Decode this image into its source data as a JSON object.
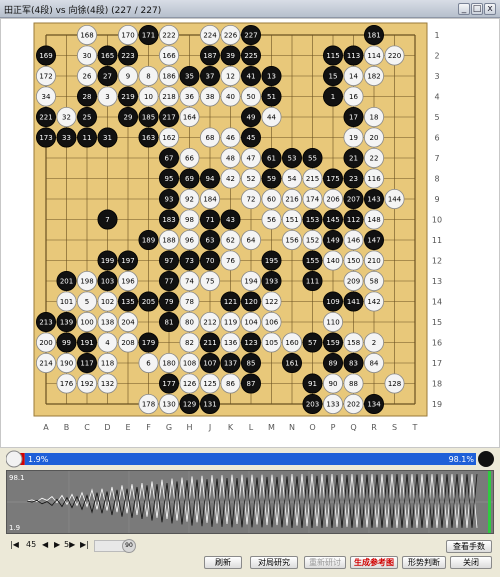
{
  "window": {
    "title": "田正军(4段) vs 向徐(4段) (227 / 227)",
    "min_label": "_",
    "max_label": "□",
    "close_label": "x"
  },
  "board": {
    "size": 19,
    "col_labels": [
      "A",
      "B",
      "C",
      "D",
      "E",
      "F",
      "G",
      "H",
      "J",
      "K",
      "L",
      "M",
      "N",
      "O",
      "P",
      "Q",
      "R",
      "S",
      "T"
    ],
    "row_labels": [
      "1",
      "2",
      "3",
      "4",
      "5",
      "6",
      "7",
      "8",
      "9",
      "10",
      "11",
      "12",
      "13",
      "14",
      "15",
      "16",
      "17",
      "18",
      "19"
    ],
    "colors": {
      "board": "#e8c87a",
      "lines": "#6a5120",
      "black": "#111111",
      "white": "#f4f4f4"
    },
    "stones": [
      [
        "C1",
        "w",
        168
      ],
      [
        "E1",
        "w",
        170
      ],
      [
        "F1",
        "b",
        171
      ],
      [
        "G1",
        "w",
        222
      ],
      [
        "J1",
        "w",
        224
      ],
      [
        "K1",
        "w",
        226
      ],
      [
        "L1",
        "b",
        227
      ],
      [
        "R1",
        "b",
        181
      ],
      [
        "A2",
        "b",
        169
      ],
      [
        "C2",
        "w",
        30
      ],
      [
        "D2",
        "b",
        165
      ],
      [
        "E2",
        "b",
        223
      ],
      [
        "G2",
        "w",
        166
      ],
      [
        "J2",
        "b",
        187
      ],
      [
        "K2",
        "b",
        39
      ],
      [
        "L2",
        "b",
        225
      ],
      [
        "P2",
        "b",
        115
      ],
      [
        "Q2",
        "b",
        113
      ],
      [
        "R2",
        "w",
        114
      ],
      [
        "S2",
        "w",
        220
      ],
      [
        "A3",
        "w",
        172
      ],
      [
        "C3",
        "w",
        26
      ],
      [
        "D3",
        "b",
        27
      ],
      [
        "E3",
        "w",
        9
      ],
      [
        "F3",
        "w",
        8
      ],
      [
        "G3",
        "w",
        186
      ],
      [
        "H3",
        "b",
        35
      ],
      [
        "J3",
        "b",
        37
      ],
      [
        "K3",
        "w",
        12
      ],
      [
        "L3",
        "b",
        41
      ],
      [
        "M3",
        "b",
        13
      ],
      [
        "P3",
        "b",
        15
      ],
      [
        "Q3",
        "w",
        14
      ],
      [
        "R3",
        "w",
        182
      ],
      [
        "A4",
        "w",
        34
      ],
      [
        "C4",
        "b",
        28
      ],
      [
        "D4",
        "w",
        3
      ],
      [
        "E4",
        "b",
        219
      ],
      [
        "F4",
        "w",
        10
      ],
      [
        "G4",
        "w",
        218
      ],
      [
        "H4",
        "w",
        36
      ],
      [
        "J4",
        "w",
        38
      ],
      [
        "K4",
        "w",
        40
      ],
      [
        "L4",
        "w",
        50
      ],
      [
        "M4",
        "b",
        51
      ],
      [
        "P4",
        "b",
        1
      ],
      [
        "Q4",
        "w",
        16
      ],
      [
        "A5",
        "b",
        221
      ],
      [
        "B5",
        "w",
        32
      ],
      [
        "C5",
        "b",
        25
      ],
      [
        "E5",
        "b",
        29
      ],
      [
        "F5",
        "b",
        185
      ],
      [
        "G5",
        "b",
        217
      ],
      [
        "H5",
        "w",
        164
      ],
      [
        "L5",
        "b",
        49
      ],
      [
        "M5",
        "w",
        44
      ],
      [
        "Q5",
        "b",
        17
      ],
      [
        "R5",
        "w",
        18
      ],
      [
        "A6",
        "b",
        173
      ],
      [
        "B6",
        "b",
        33
      ],
      [
        "C6",
        "b",
        11
      ],
      [
        "D6",
        "b",
        31
      ],
      [
        "F6",
        "b",
        163
      ],
      [
        "G6",
        "w",
        162
      ],
      [
        "J6",
        "w",
        68
      ],
      [
        "K6",
        "w",
        46
      ],
      [
        "L6",
        "b",
        45
      ],
      [
        "Q6",
        "w",
        19
      ],
      [
        "R6",
        "w",
        20
      ],
      [
        "G7",
        "b",
        67
      ],
      [
        "H7",
        "w",
        66
      ],
      [
        "K7",
        "w",
        48
      ],
      [
        "L7",
        "w",
        47
      ],
      [
        "M7",
        "b",
        61
      ],
      [
        "N7",
        "b",
        53
      ],
      [
        "O7",
        "b",
        55
      ],
      [
        "Q7",
        "b",
        21
      ],
      [
        "R7",
        "w",
        22
      ],
      [
        "G8",
        "b",
        95
      ],
      [
        "H8",
        "b",
        69
      ],
      [
        "J8",
        "b",
        94
      ],
      [
        "K8",
        "w",
        42
      ],
      [
        "L8",
        "w",
        52
      ],
      [
        "M8",
        "b",
        59
      ],
      [
        "N8",
        "w",
        54
      ],
      [
        "O8",
        "w",
        215
      ],
      [
        "P8",
        "b",
        175
      ],
      [
        "Q8",
        "b",
        23
      ],
      [
        "R8",
        "w",
        116
      ],
      [
        "G9",
        "b",
        93
      ],
      [
        "H9",
        "w",
        92
      ],
      [
        "J9",
        "w",
        184
      ],
      [
        "L9",
        "w",
        72
      ],
      [
        "M9",
        "w",
        60
      ],
      [
        "N9",
        "w",
        216
      ],
      [
        "O9",
        "w",
        174
      ],
      [
        "P9",
        "w",
        206
      ],
      [
        "Q9",
        "b",
        207
      ],
      [
        "R9",
        "b",
        143
      ],
      [
        "S9",
        "w",
        144
      ],
      [
        "D10",
        "b",
        7
      ],
      [
        "G10",
        "b",
        183
      ],
      [
        "H10",
        "w",
        98
      ],
      [
        "J10",
        "b",
        71
      ],
      [
        "K10",
        "b",
        43
      ],
      [
        "M10",
        "w",
        56
      ],
      [
        "N10",
        "w",
        151
      ],
      [
        "O10",
        "b",
        153
      ],
      [
        "P10",
        "b",
        145
      ],
      [
        "Q10",
        "b",
        112
      ],
      [
        "R10",
        "w",
        148
      ],
      [
        "F11",
        "b",
        189
      ],
      [
        "G11",
        "w",
        188
      ],
      [
        "H11",
        "w",
        96
      ],
      [
        "J11",
        "b",
        63
      ],
      [
        "K11",
        "w",
        62
      ],
      [
        "L11",
        "w",
        64
      ],
      [
        "N11",
        "w",
        156
      ],
      [
        "O11",
        "w",
        152
      ],
      [
        "P11",
        "b",
        149
      ],
      [
        "Q11",
        "w",
        146
      ],
      [
        "R11",
        "b",
        147
      ],
      [
        "D12",
        "b",
        199
      ],
      [
        "E12",
        "b",
        197
      ],
      [
        "G12",
        "b",
        97
      ],
      [
        "H12",
        "b",
        73
      ],
      [
        "J12",
        "b",
        70
      ],
      [
        "K12",
        "w",
        76
      ],
      [
        "M12",
        "b",
        195
      ],
      [
        "O12",
        "b",
        155
      ],
      [
        "P12",
        "w",
        140
      ],
      [
        "Q12",
        "w",
        150
      ],
      [
        "R12",
        "w",
        210
      ],
      [
        "B13",
        "b",
        201
      ],
      [
        "C13",
        "w",
        198
      ],
      [
        "D13",
        "b",
        103
      ],
      [
        "E13",
        "w",
        196
      ],
      [
        "G13",
        "b",
        77
      ],
      [
        "H13",
        "w",
        74
      ],
      [
        "J13",
        "w",
        75
      ],
      [
        "L13",
        "w",
        194
      ],
      [
        "M13",
        "b",
        193
      ],
      [
        "O13",
        "b",
        111
      ],
      [
        "Q13",
        "w",
        209
      ],
      [
        "R13",
        "w",
        58
      ],
      [
        "B14",
        "w",
        101
      ],
      [
        "C14",
        "w",
        5
      ],
      [
        "D14",
        "w",
        102
      ],
      [
        "E14",
        "b",
        135
      ],
      [
        "F14",
        "b",
        205
      ],
      [
        "G14",
        "b",
        79
      ],
      [
        "H14",
        "w",
        78
      ],
      [
        "K14",
        "b",
        121
      ],
      [
        "L14",
        "b",
        120
      ],
      [
        "M14",
        "w",
        122
      ],
      [
        "P14",
        "b",
        109
      ],
      [
        "Q14",
        "b",
        141
      ],
      [
        "R14",
        "w",
        142
      ],
      [
        "A15",
        "b",
        213
      ],
      [
        "B15",
        "b",
        139
      ],
      [
        "C15",
        "w",
        100
      ],
      [
        "D15",
        "w",
        138
      ],
      [
        "E15",
        "w",
        204
      ],
      [
        "G15",
        "b",
        81
      ],
      [
        "H15",
        "w",
        80
      ],
      [
        "J15",
        "w",
        212
      ],
      [
        "K15",
        "w",
        119
      ],
      [
        "L15",
        "w",
        104
      ],
      [
        "M15",
        "w",
        106
      ],
      [
        "P15",
        "w",
        110
      ],
      [
        "A16",
        "w",
        200
      ],
      [
        "B16",
        "b",
        99
      ],
      [
        "C16",
        "b",
        191
      ],
      [
        "D16",
        "w",
        4
      ],
      [
        "E16",
        "w",
        208
      ],
      [
        "F16",
        "b",
        179
      ],
      [
        "H16",
        "w",
        82
      ],
      [
        "J16",
        "b",
        211
      ],
      [
        "K16",
        "w",
        136
      ],
      [
        "L16",
        "b",
        123
      ],
      [
        "M16",
        "w",
        105
      ],
      [
        "N16",
        "w",
        160
      ],
      [
        "O16",
        "b",
        57
      ],
      [
        "P16",
        "b",
        159
      ],
      [
        "Q16",
        "w",
        158
      ],
      [
        "R16",
        "w",
        2
      ],
      [
        "A17",
        "w",
        214
      ],
      [
        "B17",
        "w",
        190
      ],
      [
        "C17",
        "b",
        117
      ],
      [
        "D17",
        "w",
        118
      ],
      [
        "F17",
        "w",
        6
      ],
      [
        "G17",
        "w",
        180
      ],
      [
        "H17",
        "w",
        108
      ],
      [
        "J17",
        "b",
        107
      ],
      [
        "K17",
        "b",
        137
      ],
      [
        "L17",
        "b",
        85
      ],
      [
        "N17",
        "b",
        161
      ],
      [
        "P17",
        "b",
        89
      ],
      [
        "Q17",
        "b",
        83
      ],
      [
        "R17",
        "w",
        84
      ],
      [
        "B18",
        "w",
        176
      ],
      [
        "C18",
        "w",
        192
      ],
      [
        "D18",
        "w",
        132
      ],
      [
        "G18",
        "b",
        177
      ],
      [
        "H18",
        "w",
        126
      ],
      [
        "J18",
        "w",
        125
      ],
      [
        "K18",
        "w",
        86
      ],
      [
        "L18",
        "b",
        87
      ],
      [
        "O18",
        "b",
        91
      ],
      [
        "P18",
        "w",
        90
      ],
      [
        "Q18",
        "w",
        88
      ],
      [
        "S18",
        "w",
        128
      ],
      [
        "F19",
        "w",
        178
      ],
      [
        "G19",
        "w",
        130
      ],
      [
        "H19",
        "b",
        129
      ],
      [
        "J19",
        "b",
        131
      ],
      [
        "O19",
        "b",
        203
      ],
      [
        "P19",
        "w",
        133
      ],
      [
        "Q19",
        "w",
        202
      ],
      [
        "R19",
        "b",
        134
      ]
    ]
  },
  "winrate": {
    "left_label": "1.9%",
    "right_label": "98.1%",
    "black_fraction": 0.019,
    "colors": {
      "black_side": "#d40000",
      "white_side": "#1e5fd8"
    }
  },
  "chart_data": {
    "type": "line",
    "ylabel_top": "98.1",
    "ylabel_bottom": "1.9",
    "series": [
      {
        "values": [
          50,
          52,
          49,
          55,
          51,
          58,
          47,
          60,
          44,
          62,
          42,
          65,
          40,
          70,
          35,
          72,
          33,
          75,
          30,
          78,
          28,
          80,
          25,
          82,
          22,
          85,
          20,
          88,
          18,
          90,
          15,
          92,
          13,
          94,
          12,
          95,
          11,
          96,
          10,
          96,
          9,
          97,
          9,
          97,
          8,
          97,
          8,
          97,
          7,
          97,
          7,
          97,
          6,
          98,
          6,
          98,
          5,
          98,
          5,
          98,
          4,
          98,
          4,
          98,
          4,
          98,
          3,
          98,
          3,
          98,
          3,
          98,
          3,
          98,
          2,
          98,
          2,
          98,
          2,
          98,
          2,
          98,
          2,
          98,
          2,
          98,
          2,
          98,
          2,
          98,
          2
        ]
      }
    ]
  },
  "controls": {
    "nav_first": "|◀",
    "nav_back_num": "45",
    "nav_prev": "◀",
    "nav_next": "▶",
    "nav_fwd_num": "5▶",
    "nav_last": "▶|",
    "slider_value": "90",
    "btn_view_moves": "查看手数",
    "btn_refresh": "刷新",
    "btn_study": "对局研究",
    "btn_restudy": "重新研讨",
    "btn_gen_ref": "生成参考图",
    "btn_judge": "形势判断",
    "btn_close": "关闭"
  }
}
